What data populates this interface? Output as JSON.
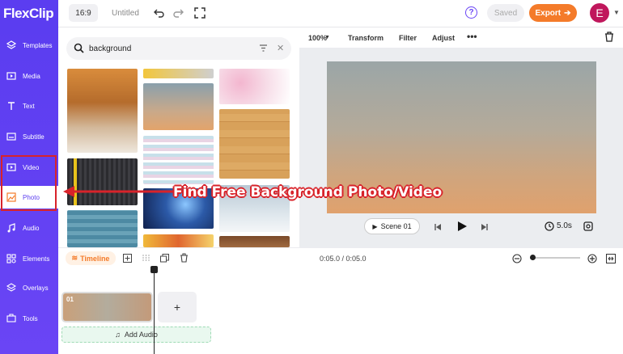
{
  "app": {
    "logo": "FlexClip"
  },
  "header": {
    "ratio": "16:9",
    "project_name": "Untitled",
    "saved_label": "Saved",
    "export_label": "Export",
    "avatar_letter": "E",
    "help_glyph": "?"
  },
  "sidebar": {
    "items": [
      {
        "label": "Templates",
        "icon": "templates-icon"
      },
      {
        "label": "Media",
        "icon": "media-icon"
      },
      {
        "label": "Text",
        "icon": "text-icon"
      },
      {
        "label": "Subtitle",
        "icon": "subtitle-icon"
      },
      {
        "label": "Video",
        "icon": "video-icon"
      },
      {
        "label": "Photo",
        "icon": "photo-icon",
        "active": true
      },
      {
        "label": "Audio",
        "icon": "audio-icon"
      },
      {
        "label": "Elements",
        "icon": "elements-icon"
      },
      {
        "label": "Overlays",
        "icon": "overlays-icon"
      },
      {
        "label": "Tools",
        "icon": "tools-icon"
      }
    ]
  },
  "search": {
    "value": "background"
  },
  "preview": {
    "zoom": "100%",
    "tools": [
      "Transform",
      "Filter",
      "Adjust"
    ],
    "scene_label": "Scene 01",
    "duration": "5.0s"
  },
  "timeline": {
    "tab_label": "Timeline",
    "time": "0:05.0 / 0:05.0",
    "clip_number": "01",
    "add_scene": "+",
    "add_audio": "Add Audio"
  },
  "annotation": {
    "callout": "Find Free Background Photo/Video",
    "color": "#d8232a"
  },
  "colors": {
    "brand": "#5b3df0",
    "accent": "#f47b2a",
    "avatar": "#c0175c"
  }
}
